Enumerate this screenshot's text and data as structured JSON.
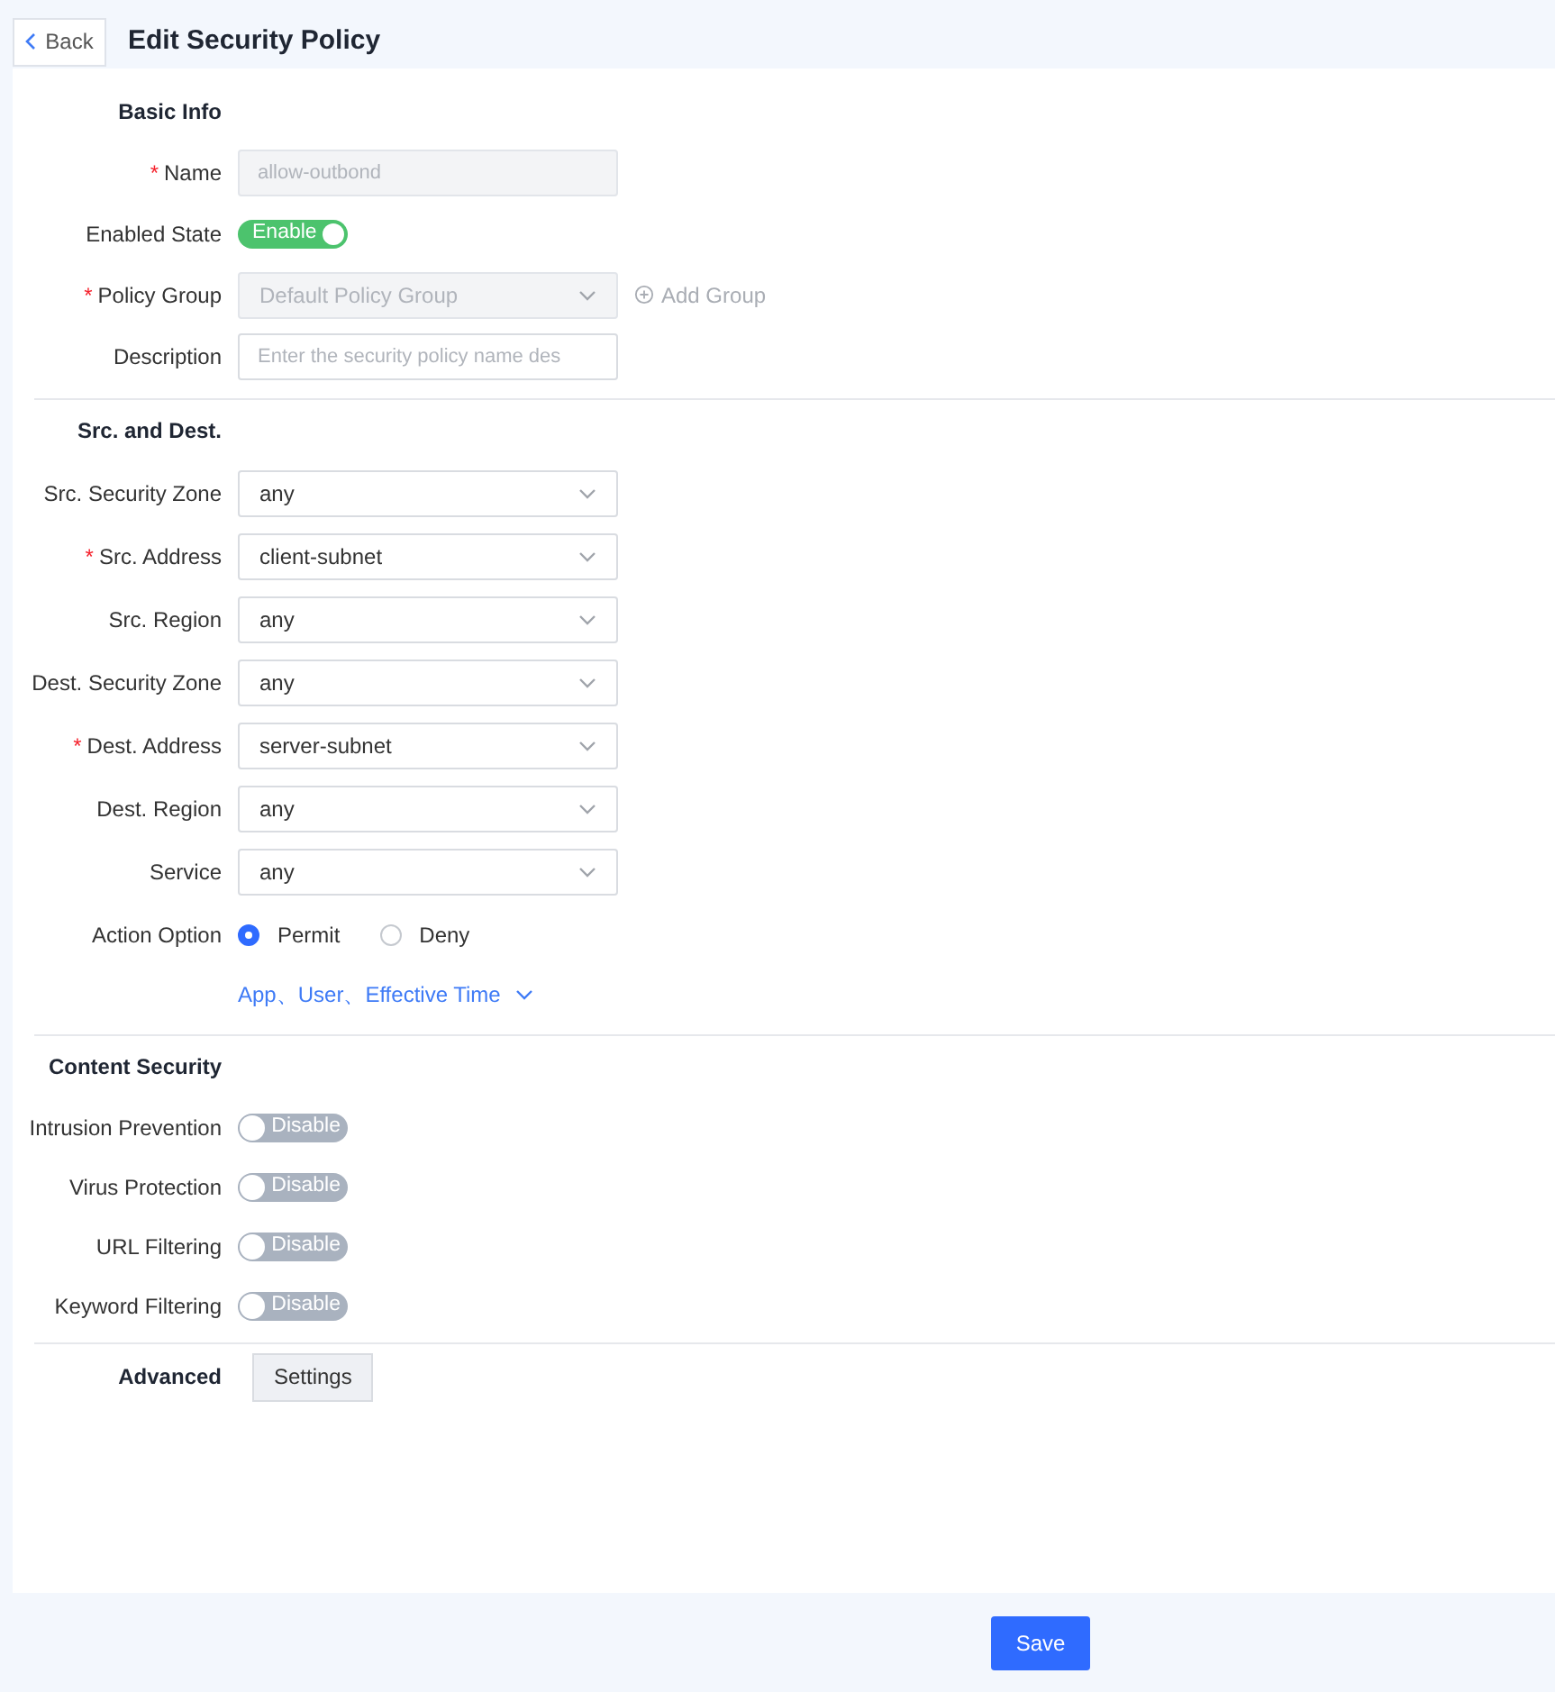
{
  "header": {
    "back": "Back",
    "title": "Edit Security Policy"
  },
  "sections": [
    {
      "title": "Basic Info",
      "fields": [
        {
          "kind": "input",
          "label": "Name",
          "mark": "*",
          "value": "allow-outbond",
          "disabled": true
        },
        {
          "kind": "toggle",
          "label": "Enabled State",
          "on": true,
          "text": "Enable"
        },
        {
          "kind": "select",
          "label": "Policy Group",
          "mark": "*",
          "value": "Default Policy Group",
          "disabled": true,
          "extra": "Add Group"
        },
        {
          "kind": "input",
          "label": "Description",
          "placeholder": "Enter the security policy name des",
          "disabled": false
        }
      ]
    },
    {
      "title": "Src. and Dest.",
      "fields": [
        {
          "kind": "select",
          "label": "Src. Security Zone",
          "value": "any",
          "disabled": false
        },
        {
          "kind": "select",
          "label": "Src. Address",
          "mark": "*",
          "value": "client-subnet",
          "disabled": false
        },
        {
          "kind": "select",
          "label": "Src. Region",
          "value": "any",
          "disabled": false
        },
        {
          "kind": "select",
          "label": "Dest. Security Zone",
          "value": "any",
          "disabled": false
        },
        {
          "kind": "select",
          "label": "Dest. Address",
          "mark": "*",
          "value": "server-subnet",
          "disabled": false
        },
        {
          "kind": "select",
          "label": "Dest. Region",
          "value": "any",
          "disabled": false
        },
        {
          "kind": "select",
          "label": "Service",
          "value": "any",
          "disabled": false
        },
        {
          "kind": "radio",
          "label": "Action Option",
          "options": [
            {
              "label": "Permit",
              "selected": true
            },
            {
              "label": "Deny",
              "selected": false
            }
          ]
        },
        {
          "kind": "link",
          "text": "App、User、Effective Time"
        }
      ]
    },
    {
      "title": "Content Security",
      "fields": [
        {
          "kind": "toggle",
          "label": "Intrusion Prevention",
          "on": false,
          "text": "Disable"
        },
        {
          "kind": "toggle",
          "label": "Virus Protection",
          "on": false,
          "text": "Disable"
        },
        {
          "kind": "toggle",
          "label": "URL Filtering",
          "on": false,
          "text": "Disable"
        },
        {
          "kind": "toggle",
          "label": "Keyword Filtering",
          "on": false,
          "text": "Disable"
        }
      ]
    }
  ],
  "advanced": {
    "label": "Advanced",
    "button": "Settings"
  },
  "save": "Save"
}
